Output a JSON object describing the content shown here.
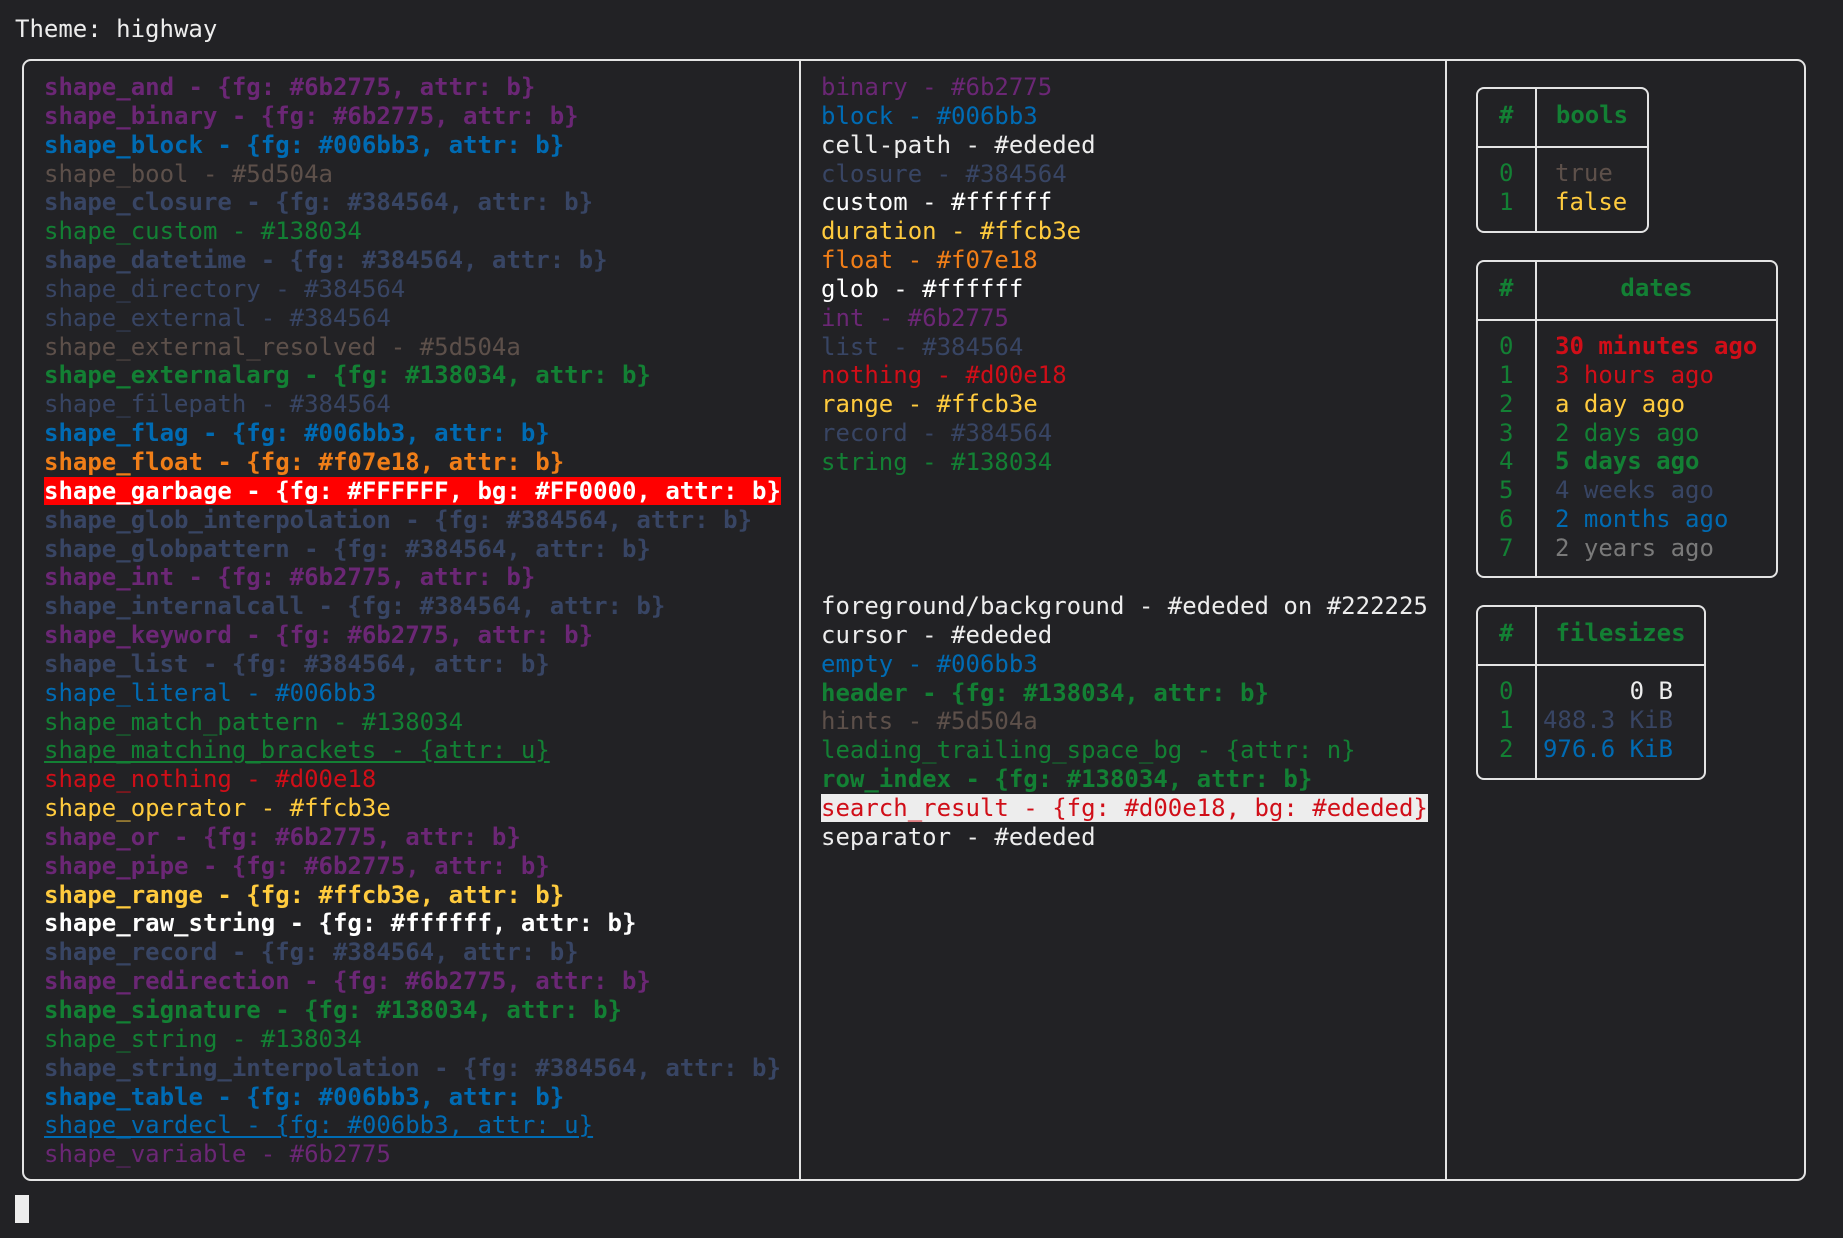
{
  "title": "Theme: highway",
  "colors": {
    "background": "#222225",
    "foreground": "#ededed",
    "purple": "#6b2775",
    "blue": "#006bb3",
    "brown": "#5d504a",
    "slate": "#384564",
    "green": "#138034",
    "orange": "#f07e18",
    "red": "#d00e18",
    "yellow": "#ffcb3e",
    "white": "#ffffff",
    "gray": "#7a7a7a"
  },
  "shapes": [
    {
      "text": "shape_and - {fg: #6b2775, attr: b}",
      "fg": "#6b2775",
      "bold": true
    },
    {
      "text": "shape_binary - {fg: #6b2775, attr: b}",
      "fg": "#6b2775",
      "bold": true
    },
    {
      "text": "shape_block - {fg: #006bb3, attr: b}",
      "fg": "#006bb3",
      "bold": true
    },
    {
      "text": "shape_bool - #5d504a",
      "fg": "#5d504a"
    },
    {
      "text": "shape_closure - {fg: #384564, attr: b}",
      "fg": "#384564",
      "bold": true
    },
    {
      "text": "shape_custom - #138034",
      "fg": "#138034"
    },
    {
      "text": "shape_datetime - {fg: #384564, attr: b}",
      "fg": "#384564",
      "bold": true
    },
    {
      "text": "shape_directory - #384564",
      "fg": "#384564"
    },
    {
      "text": "shape_external - #384564",
      "fg": "#384564"
    },
    {
      "text": "shape_external_resolved - #5d504a",
      "fg": "#5d504a"
    },
    {
      "text": "shape_externalarg - {fg: #138034, attr: b}",
      "fg": "#138034",
      "bold": true
    },
    {
      "text": "shape_filepath - #384564",
      "fg": "#384564"
    },
    {
      "text": "shape_flag - {fg: #006bb3, attr: b}",
      "fg": "#006bb3",
      "bold": true
    },
    {
      "text": "shape_float - {fg: #f07e18, attr: b}",
      "fg": "#f07e18",
      "bold": true
    },
    {
      "text": "shape_garbage - {fg: #FFFFFF, bg: #FF0000, attr: b}",
      "fg": "#FFFFFF",
      "bg": "#FF0000",
      "bold": true
    },
    {
      "text": "shape_glob_interpolation - {fg: #384564, attr: b}",
      "fg": "#384564",
      "bold": true
    },
    {
      "text": "shape_globpattern - {fg: #384564, attr: b}",
      "fg": "#384564",
      "bold": true
    },
    {
      "text": "shape_int - {fg: #6b2775, attr: b}",
      "fg": "#6b2775",
      "bold": true
    },
    {
      "text": "shape_internalcall - {fg: #384564, attr: b}",
      "fg": "#384564",
      "bold": true
    },
    {
      "text": "shape_keyword - {fg: #6b2775, attr: b}",
      "fg": "#6b2775",
      "bold": true
    },
    {
      "text": "shape_list - {fg: #384564, attr: b}",
      "fg": "#384564",
      "bold": true
    },
    {
      "text": "shape_literal - #006bb3",
      "fg": "#006bb3"
    },
    {
      "text": "shape_match_pattern - #138034",
      "fg": "#138034"
    },
    {
      "text": "shape_matching_brackets - {attr: u}",
      "fg": "#138034",
      "underline": true
    },
    {
      "text": "shape_nothing - #d00e18",
      "fg": "#d00e18"
    },
    {
      "text": "shape_operator - #ffcb3e",
      "fg": "#ffcb3e"
    },
    {
      "text": "shape_or - {fg: #6b2775, attr: b}",
      "fg": "#6b2775",
      "bold": true
    },
    {
      "text": "shape_pipe - {fg: #6b2775, attr: b}",
      "fg": "#6b2775",
      "bold": true
    },
    {
      "text": "shape_range - {fg: #ffcb3e, attr: b}",
      "fg": "#ffcb3e",
      "bold": true
    },
    {
      "text": "shape_raw_string - {fg: #ffffff, attr: b}",
      "fg": "#ffffff",
      "bold": true
    },
    {
      "text": "shape_record - {fg: #384564, attr: b}",
      "fg": "#384564",
      "bold": true
    },
    {
      "text": "shape_redirection - {fg: #6b2775, attr: b}",
      "fg": "#6b2775",
      "bold": true
    },
    {
      "text": "shape_signature - {fg: #138034, attr: b}",
      "fg": "#138034",
      "bold": true
    },
    {
      "text": "shape_string - #138034",
      "fg": "#138034"
    },
    {
      "text": "shape_string_interpolation - {fg: #384564, attr: b}",
      "fg": "#384564",
      "bold": true
    },
    {
      "text": "shape_table - {fg: #006bb3, attr: b}",
      "fg": "#006bb3",
      "bold": true
    },
    {
      "text": "shape_vardecl - {fg: #006bb3, attr: u}",
      "fg": "#006bb3",
      "underline": true
    },
    {
      "text": "shape_variable - #6b2775",
      "fg": "#6b2775"
    }
  ],
  "types": [
    {
      "text": "binary - #6b2775",
      "fg": "#6b2775"
    },
    {
      "text": "block - #006bb3",
      "fg": "#006bb3"
    },
    {
      "text": "cell-path - #ededed",
      "fg": "#ededed"
    },
    {
      "text": "closure - #384564",
      "fg": "#384564"
    },
    {
      "text": "custom - #ffffff",
      "fg": "#ffffff"
    },
    {
      "text": "duration - #ffcb3e",
      "fg": "#ffcb3e"
    },
    {
      "text": "float - #f07e18",
      "fg": "#f07e18"
    },
    {
      "text": "glob - #ffffff",
      "fg": "#ffffff"
    },
    {
      "text": "int - #6b2775",
      "fg": "#6b2775"
    },
    {
      "text": "list - #384564",
      "fg": "#384564"
    },
    {
      "text": "nothing - #d00e18",
      "fg": "#d00e18"
    },
    {
      "text": "range - #ffcb3e",
      "fg": "#ffcb3e"
    },
    {
      "text": "record - #384564",
      "fg": "#384564"
    },
    {
      "text": "string - #138034",
      "fg": "#138034"
    }
  ],
  "ui": [
    {
      "text": "foreground/background - #ededed on #222225",
      "fg": "#ededed"
    },
    {
      "text": "cursor - #ededed",
      "fg": "#ededed"
    },
    {
      "text": "empty - #006bb3",
      "fg": "#006bb3"
    },
    {
      "text": "header - {fg: #138034, attr: b}",
      "fg": "#138034",
      "bold": true
    },
    {
      "text": "hints - #5d504a",
      "fg": "#5d504a"
    },
    {
      "text": "leading_trailing_space_bg - {attr: n}",
      "fg": "#138034"
    },
    {
      "text": "row_index - {fg: #138034, attr: b}",
      "fg": "#138034",
      "bold": true
    },
    {
      "text": "search_result - {fg: #d00e18, bg: #ededed}",
      "fg": "#d00e18",
      "bg": "#ededed"
    },
    {
      "text": "separator - #ededed",
      "fg": "#ededed"
    }
  ],
  "tables": {
    "bools": {
      "index_header": "#",
      "header": "bools",
      "rows": [
        {
          "index": "0",
          "value": "true",
          "fg": "#5d504a"
        },
        {
          "index": "1",
          "value": "false",
          "fg": "#ffcb3e"
        }
      ]
    },
    "dates": {
      "index_header": "#",
      "header": "dates",
      "rows": [
        {
          "index": "0",
          "value": "30 minutes ago",
          "fg": "#d00e18",
          "bold": true
        },
        {
          "index": "1",
          "value": "3 hours ago",
          "fg": "#d00e18"
        },
        {
          "index": "2",
          "value": "a day ago",
          "fg": "#ffcb3e"
        },
        {
          "index": "3",
          "value": "2 days ago",
          "fg": "#138034"
        },
        {
          "index": "4",
          "value": "5 days ago",
          "fg": "#138034",
          "bold": true
        },
        {
          "index": "5",
          "value": "4 weeks ago",
          "fg": "#384564"
        },
        {
          "index": "6",
          "value": "2 months ago",
          "fg": "#006bb3"
        },
        {
          "index": "7",
          "value": "2 years ago",
          "fg": "#7a7a7a"
        }
      ]
    },
    "filesizes": {
      "index_header": "#",
      "header": "filesizes",
      "rows": [
        {
          "index": "0",
          "value": "0 B",
          "fg": "#ededed"
        },
        {
          "index": "1",
          "value": "488.3 KiB",
          "fg": "#384564"
        },
        {
          "index": "2",
          "value": "976.6 KiB",
          "fg": "#006bb3"
        }
      ]
    }
  }
}
